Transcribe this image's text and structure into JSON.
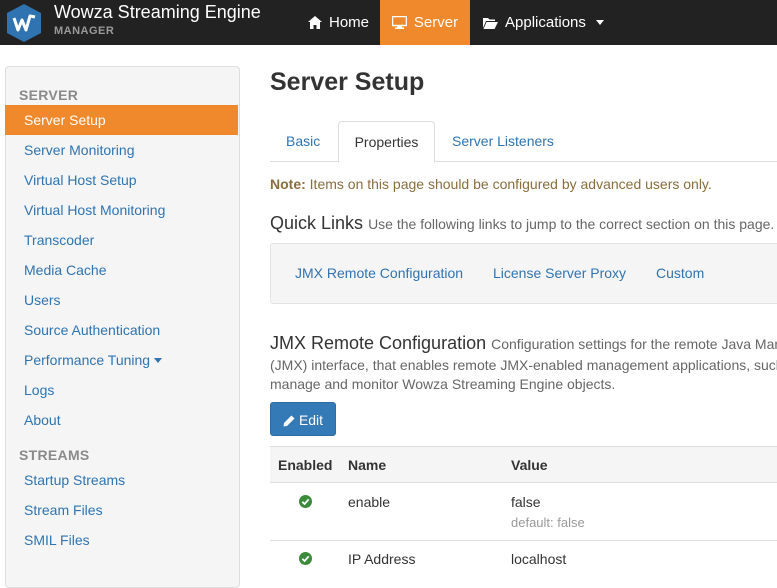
{
  "brand": {
    "title": "Wowza Streaming Engine",
    "subtitle": "MANAGER",
    "accent": "#f0892b",
    "logo_icon": "wowza-logo-icon"
  },
  "nav": [
    {
      "label": "Home",
      "icon": "home-icon"
    },
    {
      "label": "Server",
      "icon": "monitor-icon",
      "active": true
    },
    {
      "label": "Applications",
      "icon": "folder-open-icon",
      "dropdown": true
    }
  ],
  "sidebar": {
    "server_header": "SERVER",
    "server_items": [
      {
        "label": "Server Setup",
        "active": true
      },
      {
        "label": "Server Monitoring"
      },
      {
        "label": "Virtual Host Setup"
      },
      {
        "label": "Virtual Host Monitoring"
      },
      {
        "label": "Transcoder"
      },
      {
        "label": "Media Cache"
      },
      {
        "label": "Users"
      },
      {
        "label": "Source Authentication"
      },
      {
        "label": "Performance Tuning",
        "dropdown": true
      },
      {
        "label": "Logs"
      },
      {
        "label": "About"
      }
    ],
    "streams_header": "STREAMS",
    "streams_items": [
      {
        "label": "Startup Streams"
      },
      {
        "label": "Stream Files"
      },
      {
        "label": "SMIL Files"
      }
    ]
  },
  "main": {
    "title": "Server Setup",
    "tabs": [
      {
        "label": "Basic"
      },
      {
        "label": "Properties",
        "active": true
      },
      {
        "label": "Server Listeners"
      }
    ],
    "note_label": "Note:",
    "note_text": " Items on this page should be configured by advanced users only.",
    "quick_links": {
      "title": "Quick Links",
      "hint": "Use the following links to jump to the correct section on this page.",
      "links": [
        "JMX Remote Configuration",
        "License Server Proxy",
        "Custom"
      ]
    },
    "section": {
      "title": "JMX Remote Configuration",
      "desc_line1": "Configuration settings for the remote Java Mana",
      "desc_line2": "(JMX) interface, that enables remote JMX-enabled management applications, such a",
      "desc_line3": "manage and monitor Wowza Streaming Engine objects.",
      "edit_label": "Edit"
    },
    "table": {
      "headers": [
        "Enabled",
        "Name",
        "Value"
      ],
      "rows": [
        {
          "enabled": true,
          "name": "enable",
          "value": "false",
          "default": "default: false"
        },
        {
          "enabled": true,
          "name": "IP Address",
          "value": "localhost"
        }
      ]
    }
  }
}
